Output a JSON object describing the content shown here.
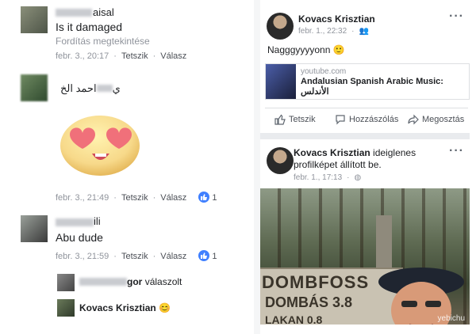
{
  "left_comments": [
    {
      "author_suffix": "aisal",
      "text": "Is it damaged",
      "translate": "Fordítás megtekintése",
      "time": "febr. 3., 20:17",
      "like": "Tetszik",
      "reply": "Válasz"
    },
    {
      "author_visible": "احمد الخ",
      "author_suffix": "ي",
      "time": "febr. 3., 21:49",
      "like": "Tetszik",
      "reply": "Válasz",
      "reactions": "1"
    },
    {
      "author_suffix": "ili",
      "text": "Abu dude",
      "time": "febr. 3., 21:59",
      "like": "Tetszik",
      "reply": "Válasz",
      "reactions": "1"
    }
  ],
  "replies": [
    {
      "author_suffix": "gor",
      "action": "válaszolt"
    },
    {
      "author": "Kovacs Krisztian",
      "emoji": "😊"
    }
  ],
  "posts": [
    {
      "author": "Kovacs Krisztian",
      "time": "febr. 1., 22:32",
      "text": "Nagggyyyyonn",
      "link_domain": "youtube.com",
      "link_title": "Andalusian Spanish Arabic Music:",
      "link_subtitle": "الأندلس",
      "actions": {
        "like": "Tetszik",
        "comment": "Hozzászólás",
        "share": "Megosztás"
      }
    },
    {
      "author": "Kovacs Krisztian",
      "action_text": "ideiglenes profilképet állított be.",
      "time": "febr. 1., 17:13",
      "sign_line1": "DOMBFOSS",
      "sign_line2": "DOMBÁS 3.8",
      "sign_line3": "LAKAN 0.8"
    }
  ],
  "watermark": "yebichu",
  "colors": {
    "accent": "#4080ff",
    "meta": "#90949c",
    "divider": "#e9ebee"
  }
}
